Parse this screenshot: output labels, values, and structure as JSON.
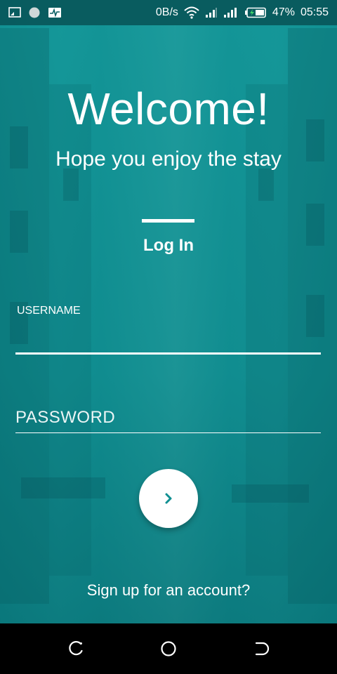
{
  "status_bar": {
    "network_speed": "0B/s",
    "battery_percent": "47%",
    "time": "05:55"
  },
  "welcome": {
    "title": "Welcome!",
    "subtitle": "Hope you enjoy the stay"
  },
  "tabs": {
    "active_label": "Log In"
  },
  "form": {
    "username_label": "USERNAME",
    "username_value": "",
    "password_placeholder": "PASSWORD",
    "password_value": ""
  },
  "signup": {
    "link_text": "Sign up for an account?"
  },
  "colors": {
    "accent": "#0f8f92",
    "text": "#ffffff"
  }
}
